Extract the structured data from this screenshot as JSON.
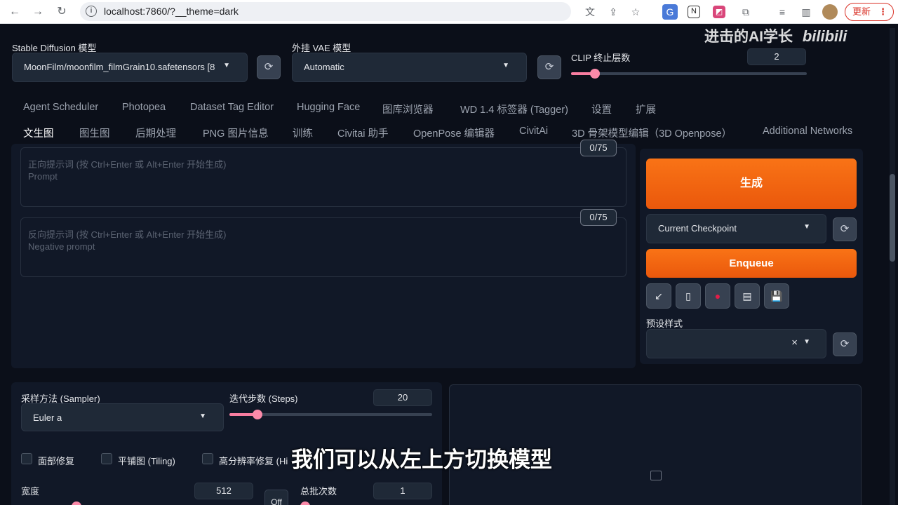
{
  "browser": {
    "back_icon": "←",
    "forward_icon": "→",
    "reload_icon": "↻",
    "url": "localhost:7860/?__theme=dark",
    "update_label": "更新",
    "update_dots": "⋮"
  },
  "top": {
    "sd_model_label": "Stable Diffusion 模型",
    "sd_model_value": "MoonFilm/moonfilm_filmGrain10.safetensors [8",
    "vae_label": "外挂 VAE 模型",
    "vae_value": "Automatic",
    "clip_label": "CLIP 终止层数",
    "clip_value": "2",
    "clip_fraction": 0.1
  },
  "tabs_row1": [
    "Agent Scheduler",
    "Photopea",
    "Dataset Tag Editor",
    "Hugging Face",
    "图库浏览器",
    "WD 1.4 标签器 (Tagger)",
    "设置",
    "扩展"
  ],
  "tabs_row2": [
    "文生图",
    "图生图",
    "后期处理",
    "PNG 图片信息",
    "训练",
    "Civitai 助手",
    "OpenPose 编辑器",
    "CivitAi",
    "3D 骨架模型编辑（3D Openpose）",
    "Additional Networks"
  ],
  "prompt": {
    "placeholder_line1": "正向提示词 (按 Ctrl+Enter 或 Alt+Enter 开始生成)",
    "placeholder_line2": "Prompt",
    "token_count": "0/75"
  },
  "negative_prompt": {
    "placeholder_line1": "反向提示词 (按 Ctrl+Enter 或 Alt+Enter 开始生成)",
    "placeholder_line2": "Negative prompt",
    "token_count": "0/75"
  },
  "actions": {
    "generate_label": "生成",
    "checkpoint_value": "Current Checkpoint",
    "enqueue_label": "Enqueue",
    "styles_label": "预设样式",
    "clear_icon": "×"
  },
  "sampler": {
    "label": "采样方法 (Sampler)",
    "value": "Euler a"
  },
  "steps": {
    "label": "迭代步数 (Steps)",
    "value": "20",
    "fraction": 0.14
  },
  "options": {
    "face_restore": "面部修复",
    "tiling": "平铺图 (Tiling)",
    "hires": "高分辨率修复 (Hi"
  },
  "width": {
    "label": "宽度",
    "value": "512"
  },
  "batch_count": {
    "label": "总批次数",
    "value": "1"
  },
  "off_label": "Off",
  "watermark": "进击的AI学长",
  "watermark_logo": "bilibili",
  "subtitle": "我们可以从左上方切换模型"
}
